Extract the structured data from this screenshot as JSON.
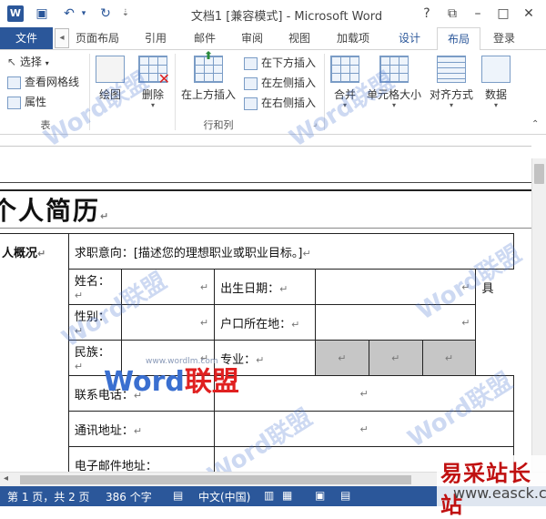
{
  "app": {
    "logo": "W",
    "title": "文档1 [兼容模式] - Microsoft Word",
    "window_controls": {
      "help": "?",
      "ribbon_options": "⧉",
      "minimize": "–",
      "restore": "□",
      "close": "✕"
    }
  },
  "qat": {
    "save_icon": "save-icon",
    "undo_icon": "undo-icon",
    "redo_icon": "redo-icon",
    "customize_icon": "customize-icon"
  },
  "tabs": {
    "file": "文件",
    "page_layout": "页面布局",
    "references": "引用",
    "mailings": "邮件",
    "review": "审阅",
    "view": "视图",
    "addins": "加载项",
    "design": "设计",
    "layout": "布局",
    "signin": "登录"
  },
  "ribbon": {
    "select": "选择",
    "view_gridlines": "查看网格线",
    "properties": "属性",
    "group_table": "表",
    "draw": "绘图",
    "delete": "删除",
    "insert_above": "在上方插入",
    "insert_below": "在下方插入",
    "insert_left": "在左侧插入",
    "insert_right": "在右侧插入",
    "group_rows_cols": "行和列",
    "merge": "合并",
    "cell_size": "单元格大小",
    "alignment": "对齐方式",
    "data": "数据"
  },
  "document": {
    "heading": "个人简历",
    "section_label": "人概况",
    "objective": "求职意向：[描述您的理想职业或职业目标。]",
    "name_label": "姓名：",
    "birthdate_label": "出生日期：",
    "gender_label": "性别：",
    "hukou_label": "户口所在地：",
    "ethnicity_label": "民族：",
    "major_label": "专业：",
    "phone_label": "联系电话：",
    "address_label": "通讯地址：",
    "email_label": "电子邮件地址：",
    "para_mark": "↵",
    "right_edge_1": "具",
    "right_edge_2": "/"
  },
  "watermark": {
    "brand": "Word",
    "brand_cn": "联盟",
    "url": "www.wordlm.com"
  },
  "status": {
    "page": "第 1 页，共 2 页",
    "words": "386 个字",
    "language": "中文(中国)"
  },
  "site_badge": {
    "cn": "易采站长站",
    "en": "www.easck.com"
  }
}
